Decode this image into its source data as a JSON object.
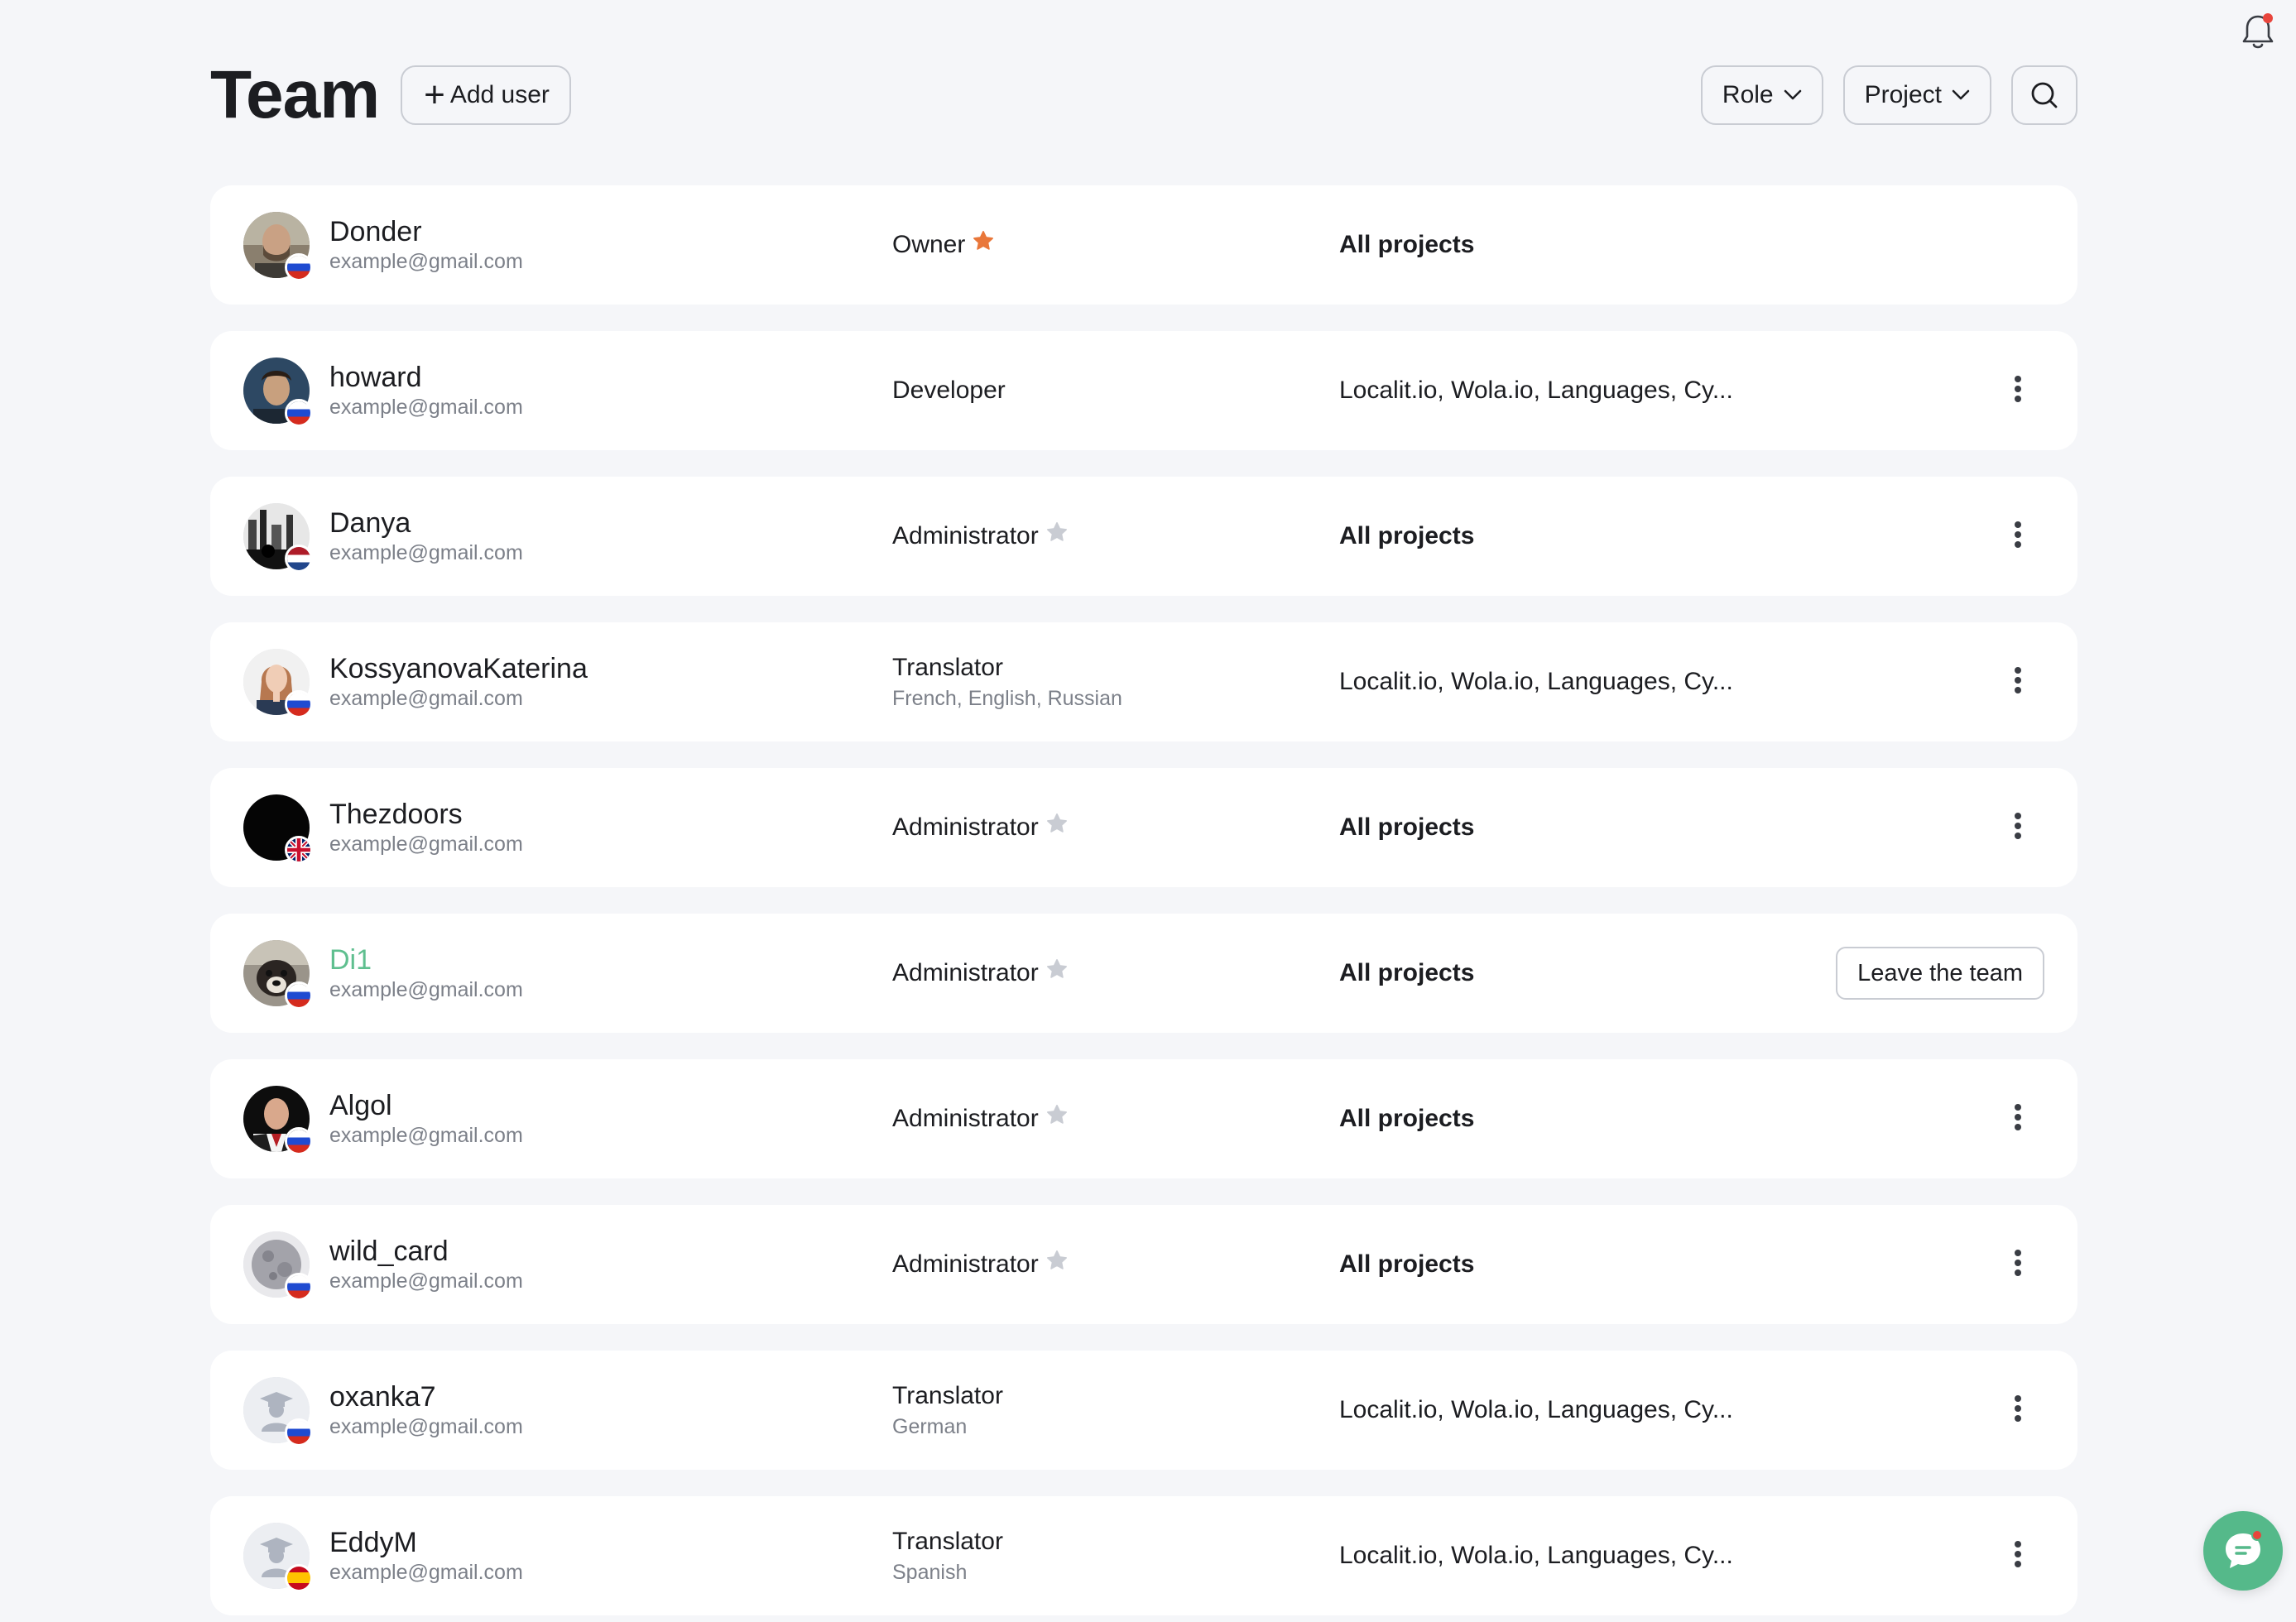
{
  "header": {
    "title": "Team",
    "add_user_label": "Add user",
    "filters": [
      {
        "label": "Role"
      },
      {
        "label": "Project"
      }
    ]
  },
  "colors": {
    "owner_star": "#e9773a",
    "admin_star": "#c9ccd3",
    "current_user_name": "#5fbf8f",
    "chat_button": "#55b98a",
    "notification_dot": "#e8453c"
  },
  "members": [
    {
      "name": "Donder",
      "email": "example@gmail.com",
      "role": "Owner",
      "star": "owner",
      "languages": "",
      "projects": "All projects",
      "projects_all": true,
      "action": "none",
      "flag": "ru",
      "avatar": "photo-man-1"
    },
    {
      "name": "howard",
      "email": "example@gmail.com",
      "role": "Developer",
      "star": "none",
      "languages": "",
      "projects": "Localit.io, Wola.io, Languages, Cy...",
      "projects_all": false,
      "action": "menu",
      "flag": "ru",
      "avatar": "photo-man-2"
    },
    {
      "name": "Danya",
      "email": "example@gmail.com",
      "role": "Administrator",
      "star": "admin",
      "languages": "",
      "projects": "All projects",
      "projects_all": true,
      "action": "menu",
      "flag": "nl",
      "avatar": "photo-city"
    },
    {
      "name": "KossyanovaKaterina",
      "email": "example@gmail.com",
      "role": "Translator",
      "star": "none",
      "languages": "French, English, Russian",
      "projects": "Localit.io, Wola.io, Languages, Cy...",
      "projects_all": false,
      "action": "menu",
      "flag": "ru",
      "avatar": "photo-woman"
    },
    {
      "name": "Thezdoors",
      "email": "example@gmail.com",
      "role": "Administrator",
      "star": "admin",
      "languages": "",
      "projects": "All projects",
      "projects_all": true,
      "action": "menu",
      "flag": "gb",
      "avatar": "photo-black"
    },
    {
      "name": "Di1",
      "email": "example@gmail.com",
      "role": "Administrator",
      "star": "admin",
      "languages": "",
      "projects": "All projects",
      "projects_all": true,
      "action": "leave",
      "action_label": "Leave the team",
      "flag": "ru",
      "avatar": "photo-dog",
      "is_current_user": true
    },
    {
      "name": "Algol",
      "email": "example@gmail.com",
      "role": "Administrator",
      "star": "admin",
      "languages": "",
      "projects": "All projects",
      "projects_all": true,
      "action": "menu",
      "flag": "ru",
      "avatar": "photo-man-3"
    },
    {
      "name": "wild_card",
      "email": "example@gmail.com",
      "role": "Administrator",
      "star": "admin",
      "languages": "",
      "projects": "All projects",
      "projects_all": true,
      "action": "menu",
      "flag": "ru",
      "avatar": "photo-moon"
    },
    {
      "name": "oxanka7",
      "email": "example@gmail.com",
      "role": "Translator",
      "star": "none",
      "languages": "German",
      "projects": "Localit.io, Wola.io, Languages, Cy...",
      "projects_all": false,
      "action": "menu",
      "flag": "ru",
      "avatar": "placeholder-graduate"
    },
    {
      "name": "EddyM",
      "email": "example@gmail.com",
      "role": "Translator",
      "star": "none",
      "languages": "Spanish",
      "projects": "Localit.io, Wola.io, Languages, Cy...",
      "projects_all": false,
      "action": "menu",
      "flag": "es",
      "avatar": "placeholder-graduate"
    }
  ]
}
